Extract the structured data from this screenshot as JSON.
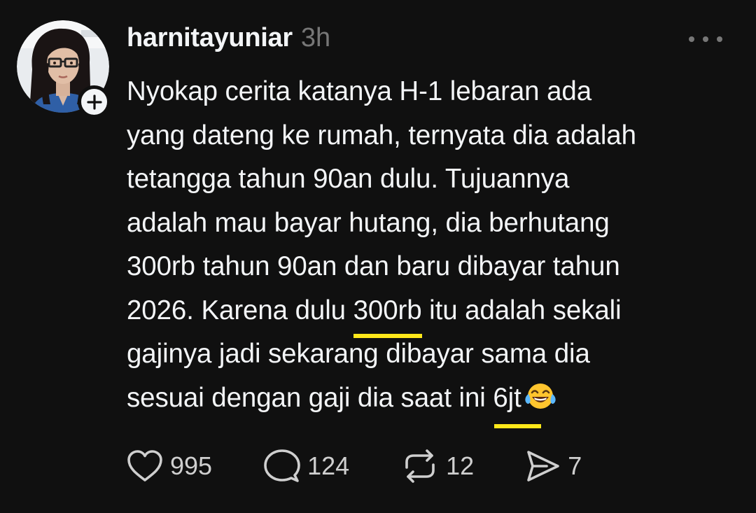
{
  "post": {
    "username": "harnitayuniar",
    "time": "3h",
    "body_lines": [
      "Nyokap cerita katanya H-1 lebaran ada",
      "yang dateng ke rumah, ternyata dia adalah",
      "tetangga tahun 90an dulu. Tujuannya",
      "adalah mau bayar hutang, dia berhutang",
      "300rb tahun 90an dan baru dibayar tahun"
    ],
    "line6": {
      "before": "2026. Karena dulu ",
      "highlight": "300rb",
      "after": " itu adalah sekali"
    },
    "line7": "gajinya jadi sekarang dibayar sama dia",
    "line8": {
      "before": "sesuai dengan gaji dia saat ini ",
      "highlight": "6jt"
    },
    "emoji": "face-with-tears-of-joy",
    "highlight_color": "#ffe81a"
  },
  "actions": {
    "likes": "995",
    "replies": "124",
    "reposts": "12",
    "shares": "7"
  },
  "icons": {
    "like": "heart-icon",
    "reply": "speech-bubble-icon",
    "repost": "repost-icon",
    "share": "send-icon",
    "more": "more-dots-icon",
    "follow": "plus-icon"
  }
}
